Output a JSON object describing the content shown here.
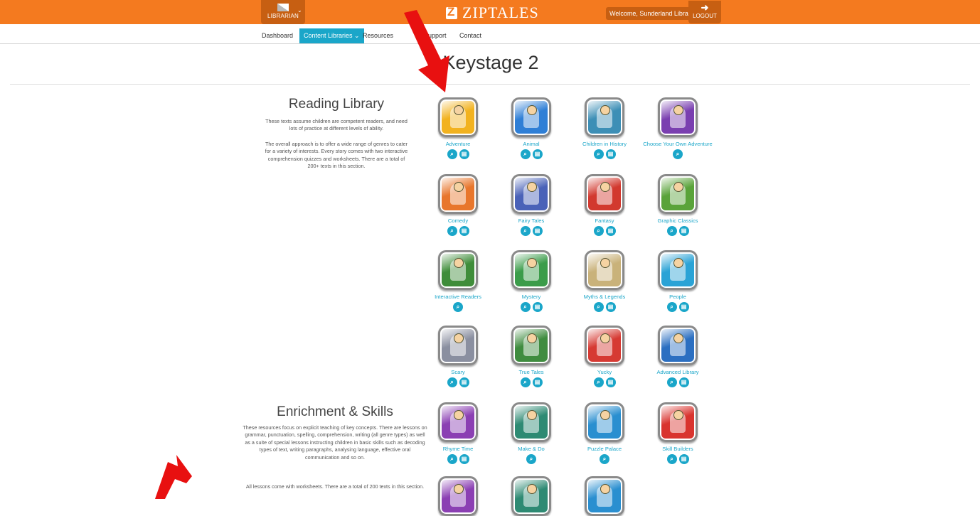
{
  "topbar": {
    "librarian_label": "LIBRARIAN",
    "logo_text": "ZIPTALES",
    "welcome_text": "Welcome, Sunderland Libraries!",
    "logout_label": "LOGOUT",
    "brand_color": "#f47a1f"
  },
  "nav": {
    "items": [
      {
        "label": "Dashboard"
      },
      {
        "label": "Content Libraries"
      },
      {
        "label": "Resources"
      },
      {
        "label": "/ Support"
      },
      {
        "label": "Contact"
      }
    ],
    "active_color": "#1aa6c9"
  },
  "page": {
    "title": "Keystage 2"
  },
  "reading_library": {
    "title": "Reading Library",
    "para1": "These texts assume children are competent readers, and need lots of practice at different levels of ability.",
    "para2": "The overall approach is to offer a wide range of genres to cater for a variety of interests. Every story comes with two interactive comprehension quizzes and worksheets. There are a total of 200+ texts in this section."
  },
  "enrichment": {
    "title": "Enrichment & Skills",
    "para1": "These resources focus on explicit teaching of key concepts. There are lessons on grammar, punctuation, spelling, comprehension, writing (all genre types) as well as a suite of special lessons instructing children in basic skills such as decoding types of text, writing paragraphs, analysing language, effective oral communication and so on.",
    "para2": "All lessons come with worksheets. There are a total of 200 texts in this section."
  },
  "tiles": [
    {
      "label": "Adventure",
      "icon": "adventure-icon",
      "color": "#f2b21f"
    },
    {
      "label": "Animal",
      "icon": "animal-icon",
      "color": "#2f7fd6"
    },
    {
      "label": "Children in History",
      "icon": "children-in-history-icon",
      "color": "#3d8fb6"
    },
    {
      "label": "Choose Your Own Adventure",
      "icon": "choose-your-own-adventure-icon",
      "color": "#7a3fb0"
    },
    {
      "label": "Comedy",
      "icon": "comedy-icon",
      "color": "#e8762c"
    },
    {
      "label": "Fairy Tales",
      "icon": "fairy-tales-icon",
      "color": "#4a62b8"
    },
    {
      "label": "Fantasy",
      "icon": "fantasy-icon",
      "color": "#d2392f"
    },
    {
      "label": "Graphic Classics",
      "icon": "graphic-classics-icon",
      "color": "#5aa33a"
    },
    {
      "label": "Interactive Readers",
      "icon": "interactive-readers-icon",
      "color": "#3f8d3a"
    },
    {
      "label": "Mystery",
      "icon": "mystery-icon",
      "color": "#3b9c4a"
    },
    {
      "label": "Myths & Legends",
      "icon": "myths-legends-icon",
      "color": "#c9b27a"
    },
    {
      "label": "People",
      "icon": "people-icon",
      "color": "#2aa3d6"
    },
    {
      "label": "Scary",
      "icon": "scary-icon",
      "color": "#8a8fa0"
    },
    {
      "label": "True Tales",
      "icon": "true-tales-icon",
      "color": "#3f8c3f"
    },
    {
      "label": "Yucky",
      "icon": "yucky-icon",
      "color": "#d63a33"
    },
    {
      "label": "Advanced Library",
      "icon": "advanced-library-icon",
      "color": "#2b6fc1"
    },
    {
      "label": "Rhyme Time",
      "icon": "rhyme-time-icon",
      "color": "#8b3fb3"
    },
    {
      "label": "Make & Do",
      "icon": "make-and-do-icon",
      "color": "#2e8a73"
    },
    {
      "label": "Puzzle Palace",
      "icon": "puzzle-palace-icon",
      "color": "#2a8fd0"
    },
    {
      "label": "Skill Builders",
      "icon": "skill-builders-icon",
      "color": "#d9342f"
    },
    {
      "label": "",
      "icon": "enrichment-tile-5-icon",
      "color": "#8b3fb3"
    },
    {
      "label": "",
      "icon": "enrichment-tile-6-icon",
      "color": "#2e8a73"
    },
    {
      "label": "",
      "icon": "enrichment-tile-7-icon",
      "color": "#2a8fd0"
    }
  ]
}
